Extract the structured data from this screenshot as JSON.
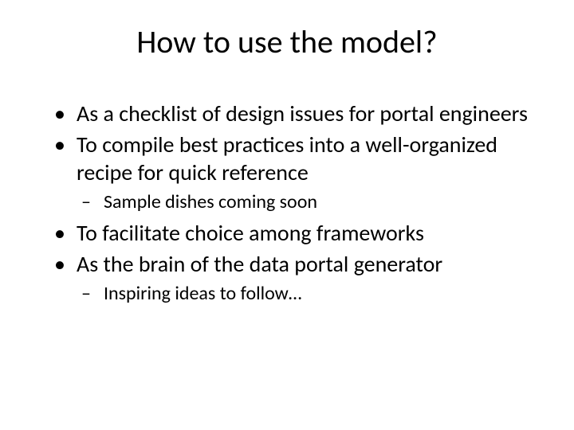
{
  "title": "How to use the model?",
  "bullets": {
    "b0": "As a checklist of design issues for portal engineers",
    "b1": "To compile best practices into a well-organized recipe for quick reference",
    "b1_sub0": "Sample dishes coming soon",
    "b2": "To facilitate choice among frameworks",
    "b3": "As the brain of the data portal generator",
    "b3_sub0": "Inspiring ideas to follow…"
  }
}
